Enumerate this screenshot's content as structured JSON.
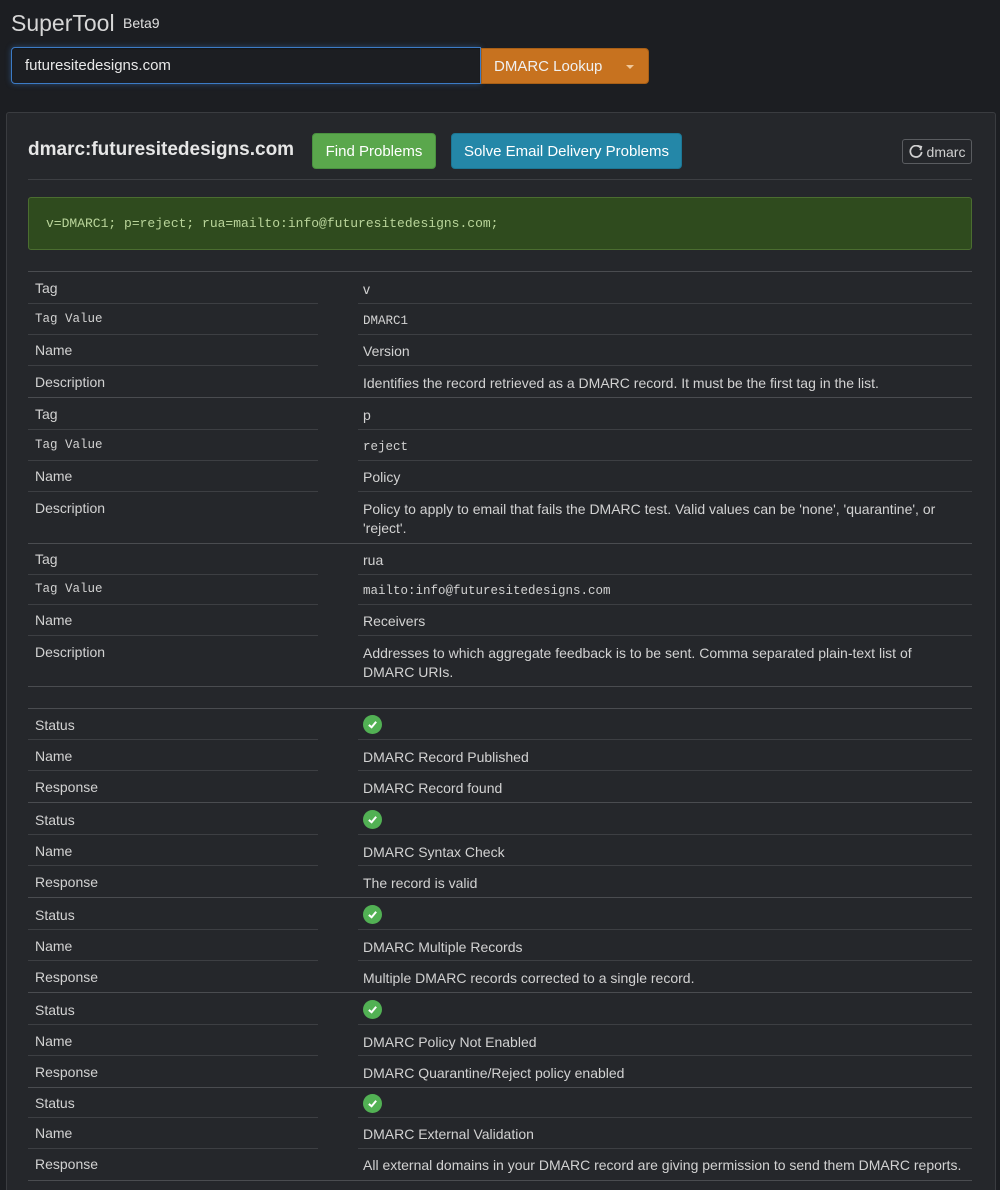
{
  "app": {
    "title": "SuperTool",
    "badge": "Beta9"
  },
  "search": {
    "value": "futuresitedesigns.com",
    "button_label": "DMARC Lookup"
  },
  "panel": {
    "title": "dmarc:futuresitedesigns.com",
    "find_problems_label": "Find Problems",
    "solve_label": "Solve Email Delivery Problems",
    "refresh_label": "dmarc",
    "record": "v=DMARC1; p=reject; rua=mailto:info@futuresitedesigns.com;"
  },
  "tags": [
    {
      "tag_k": "Tag",
      "tag": "v",
      "value_k": "Tag Value",
      "value": "DMARC1",
      "name_k": "Name",
      "name": "Version",
      "desc_k": "Description",
      "desc": "Identifies the record retrieved as a DMARC record. It must be the first tag in the list."
    },
    {
      "tag_k": "Tag",
      "tag": "p",
      "value_k": "Tag Value",
      "value": "reject",
      "name_k": "Name",
      "name": "Policy",
      "desc_k": "Description",
      "desc": "Policy to apply to email that fails the DMARC test. Valid values can be 'none', 'quarantine', or 'reject'."
    },
    {
      "tag_k": "Tag",
      "tag": "rua",
      "value_k": "Tag Value",
      "value": "mailto:info@futuresitedesigns.com",
      "name_k": "Name",
      "name": "Receivers",
      "desc_k": "Description",
      "desc": "Addresses to which aggregate feedback is to be sent. Comma separated plain-text list of DMARC URIs."
    }
  ],
  "checks": [
    {
      "status_k": "Status",
      "status": "pass",
      "name_k": "Name",
      "name": "DMARC Record Published",
      "resp_k": "Response",
      "response": "DMARC Record found"
    },
    {
      "status_k": "Status",
      "status": "pass",
      "name_k": "Name",
      "name": "DMARC Syntax Check",
      "resp_k": "Response",
      "response": "The record is valid"
    },
    {
      "status_k": "Status",
      "status": "pass",
      "name_k": "Name",
      "name": "DMARC Multiple Records",
      "resp_k": "Response",
      "response": "Multiple DMARC records corrected to a single record."
    },
    {
      "status_k": "Status",
      "status": "pass",
      "name_k": "Name",
      "name": "DMARC Policy Not Enabled",
      "resp_k": "Response",
      "response": "DMARC Quarantine/Reject policy enabled"
    },
    {
      "status_k": "Status",
      "status": "pass",
      "name_k": "Name",
      "name": "DMARC External Validation",
      "resp_k": "Response",
      "response": "All external domains in your DMARC record are giving permission to send them DMARC reports."
    }
  ],
  "icons": {
    "status_pass": "check-circle-icon",
    "refresh": "refresh-icon",
    "caret": "caret-down-icon"
  },
  "colors": {
    "accent_orange": "#c7721f",
    "success_green": "#5aa74c",
    "info_blue": "#2487a8",
    "record_bg": "#2f4b1e"
  }
}
